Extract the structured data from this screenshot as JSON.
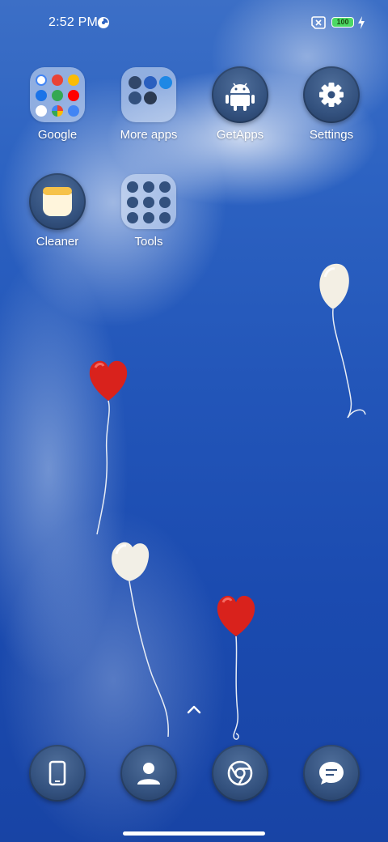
{
  "status_bar": {
    "time": "2:52 PM",
    "battery_level": "100",
    "battery_color": "#4cd964",
    "icons": [
      "privacy-icon",
      "no-sim-icon",
      "battery-icon",
      "charging-icon"
    ]
  },
  "apps": [
    {
      "label": "Google",
      "kind": "folder"
    },
    {
      "label": "More apps",
      "kind": "folder"
    },
    {
      "label": "GetApps",
      "kind": "app",
      "icon": "android-icon"
    },
    {
      "label": "Settings",
      "kind": "app",
      "icon": "gear-icon"
    },
    {
      "label": "Cleaner",
      "kind": "app",
      "icon": "cleaner-icon"
    },
    {
      "label": "Tools",
      "kind": "folder"
    }
  ],
  "dock": [
    {
      "icon": "phone-icon"
    },
    {
      "icon": "contacts-icon"
    },
    {
      "icon": "chrome-icon"
    },
    {
      "icon": "messages-icon"
    }
  ],
  "wallpaper": {
    "sky_color": "#2356b9",
    "balloons": [
      "red-heart",
      "red-heart",
      "white-heart",
      "white-heart"
    ]
  },
  "swipe_icon": "chevron-up-icon"
}
